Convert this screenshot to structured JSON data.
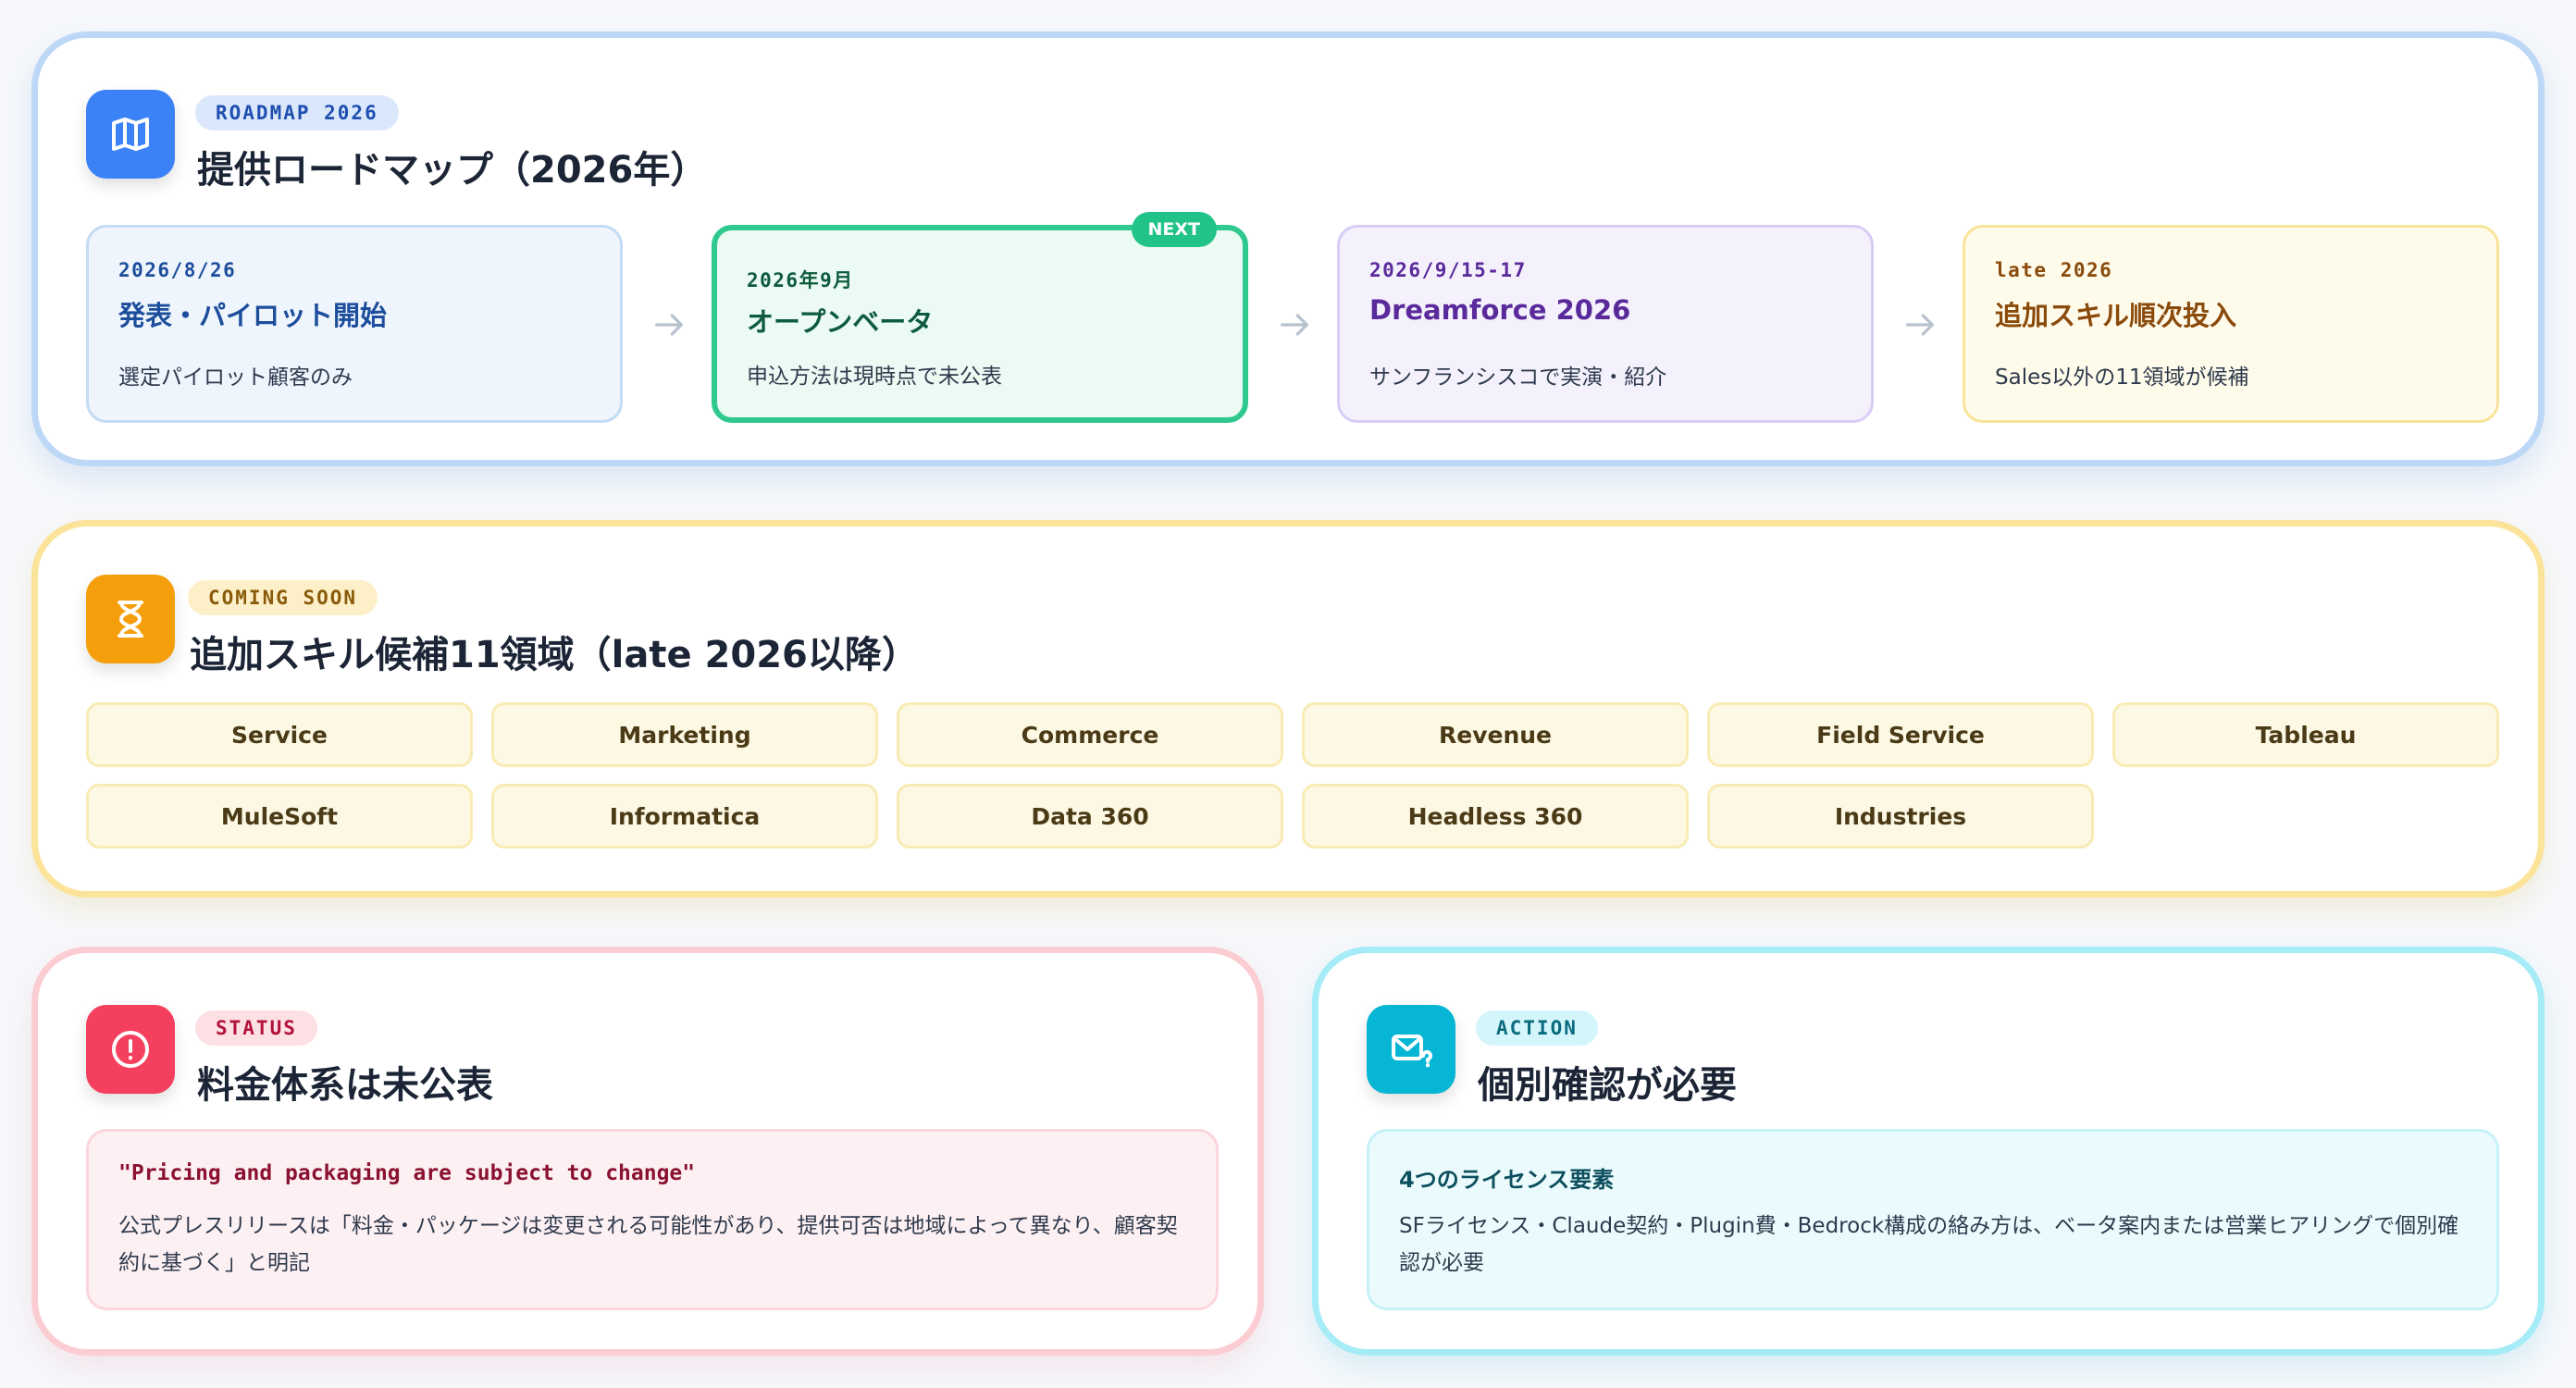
{
  "roadmap": {
    "badge": "ROADMAP 2026",
    "title": "提供ロードマップ（2026年）",
    "icon": "map-icon",
    "steps": [
      {
        "date": "2026/8/26",
        "title": "発表・パイロット開始",
        "desc": "選定パイロット顧客のみ",
        "color": "#1d4e9b"
      },
      {
        "date": "2026年9月",
        "title": "オープンベータ",
        "desc": "申込方法は現時点で未公表",
        "badge": "NEXT",
        "color": "#0d5a3e"
      },
      {
        "date": "2026/9/15-17",
        "title": "Dreamforce 2026",
        "desc": "サンフランシスコで実演・紹介",
        "color": "#5a2a9a"
      },
      {
        "date": "late 2026",
        "title": "追加スキル順次投入",
        "desc": "Sales以外の11領域が候補",
        "color": "#8a4a0b"
      }
    ]
  },
  "coming_soon": {
    "badge": "COMING SOON",
    "title": "追加スキル候補11領域（late 2026以降）",
    "icon": "hourglass-icon",
    "chips": [
      "Service",
      "Marketing",
      "Commerce",
      "Revenue",
      "Field Service",
      "Tableau",
      "MuleSoft",
      "Informatica",
      "Data 360",
      "Headless 360",
      "Industries"
    ]
  },
  "status": {
    "badge": "STATUS",
    "title": "料金体系は未公表",
    "icon": "alert-circle-icon",
    "quote": "\"Pricing and packaging are subject to change\"",
    "body": "公式プレスリリースは「料金・パッケージは変更される可能性があり、提供可否は地域によって異なり、顧客契約に基づく」と明記"
  },
  "action": {
    "badge": "ACTION",
    "title": "個別確認が必要",
    "icon": "mail-question-icon",
    "heading": "4つのライセンス要素",
    "body": "SFライセンス・Claude契約・Plugin費・Bedrock構成の絡み方は、ベータ案内または営業ヒアリングで個別確認が必要"
  },
  "colors": {
    "blue": "#3b82f6",
    "amber": "#f59e0b",
    "rose": "#f43f5e",
    "cyan": "#06b6d4",
    "green": "#22c389"
  }
}
